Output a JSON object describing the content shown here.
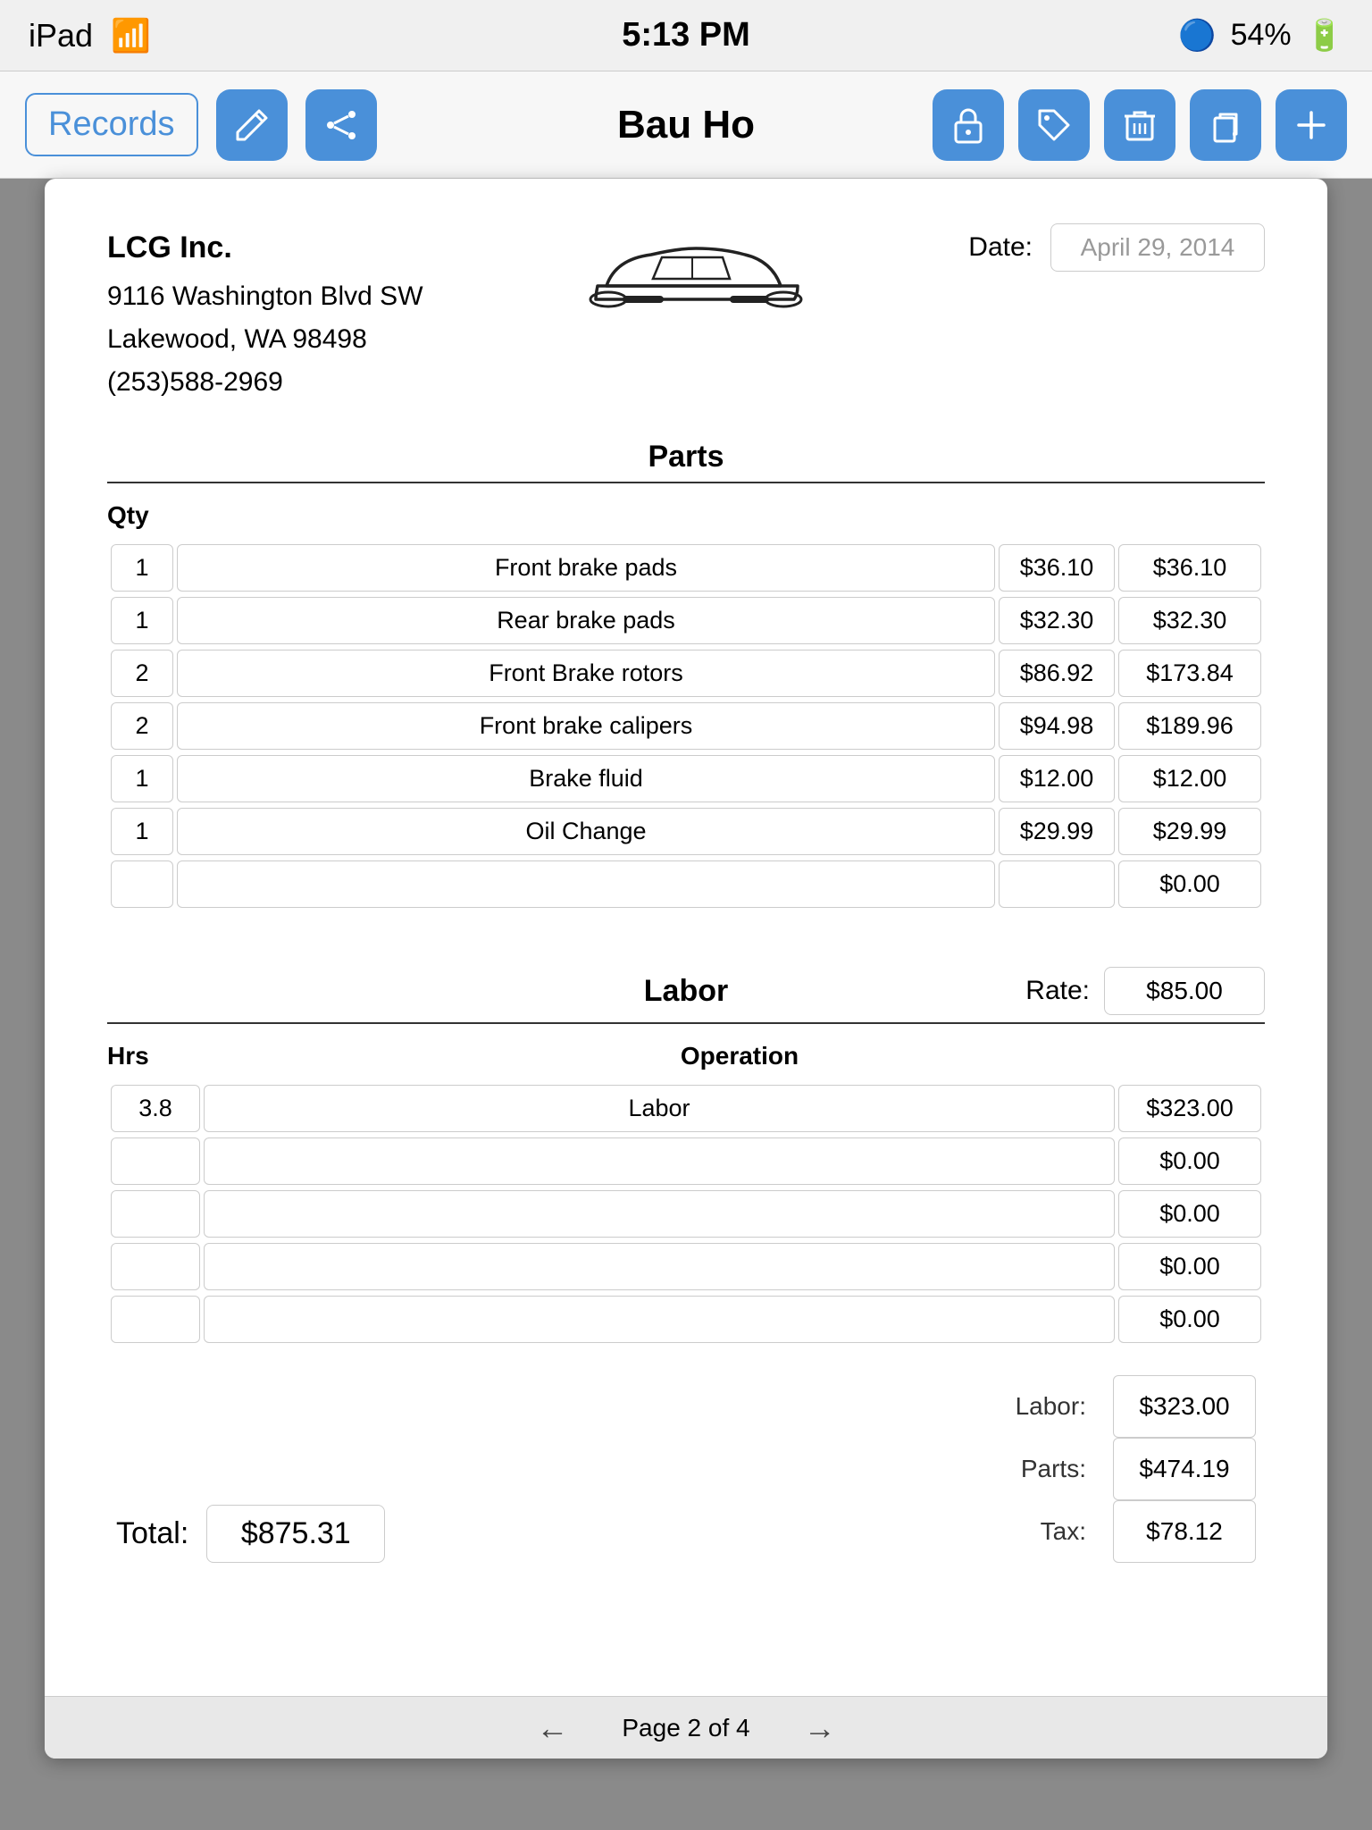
{
  "statusBar": {
    "device": "iPad",
    "wifi": "wifi",
    "time": "5:13 PM",
    "bluetooth": "54%"
  },
  "navBar": {
    "title": "Bau Ho",
    "recordsLabel": "Records"
  },
  "document": {
    "company": {
      "name": "LCG Inc.",
      "address1": "9116 Washington Blvd SW",
      "address2": "Lakewood, WA  98498",
      "phone": "(253)588-2969"
    },
    "dateLabel": "Date:",
    "dateValue": "April 29, 2014",
    "partsTitle": "Parts",
    "qtyHeader": "Qty",
    "parts": [
      {
        "qty": "1",
        "desc": "Front brake pads",
        "price": "$36.10",
        "total": "$36.10"
      },
      {
        "qty": "1",
        "desc": "Rear brake pads",
        "price": "$32.30",
        "total": "$32.30"
      },
      {
        "qty": "2",
        "desc": "Front Brake rotors",
        "price": "$86.92",
        "total": "$173.84"
      },
      {
        "qty": "2",
        "desc": "Front brake calipers",
        "price": "$94.98",
        "total": "$189.96"
      },
      {
        "qty": "1",
        "desc": "Brake fluid",
        "price": "$12.00",
        "total": "$12.00"
      },
      {
        "qty": "1",
        "desc": "Oil Change",
        "price": "$29.99",
        "total": "$29.99"
      },
      {
        "qty": "",
        "desc": "",
        "price": "",
        "total": "$0.00"
      }
    ],
    "laborTitle": "Labor",
    "rateLabel": "Rate:",
    "rateValue": "$85.00",
    "hrsHeader": "Hrs",
    "operationHeader": "Operation",
    "labor": [
      {
        "hrs": "3.8",
        "op": "Labor",
        "amount": "$323.00"
      },
      {
        "hrs": "",
        "op": "",
        "amount": "$0.00"
      },
      {
        "hrs": "",
        "op": "",
        "amount": "$0.00"
      },
      {
        "hrs": "",
        "op": "",
        "amount": "$0.00"
      },
      {
        "hrs": "",
        "op": "",
        "amount": "$0.00"
      }
    ],
    "totals": {
      "totalLabel": "Total:",
      "totalValue": "$875.31",
      "laborLabel": "Labor:",
      "laborValue": "$323.00",
      "partsLabel": "Parts:",
      "partsValue": "$474.19",
      "taxLabel": "Tax:",
      "taxValue": "$78.12"
    },
    "footer": {
      "pageText": "Page 2 of 4"
    }
  }
}
